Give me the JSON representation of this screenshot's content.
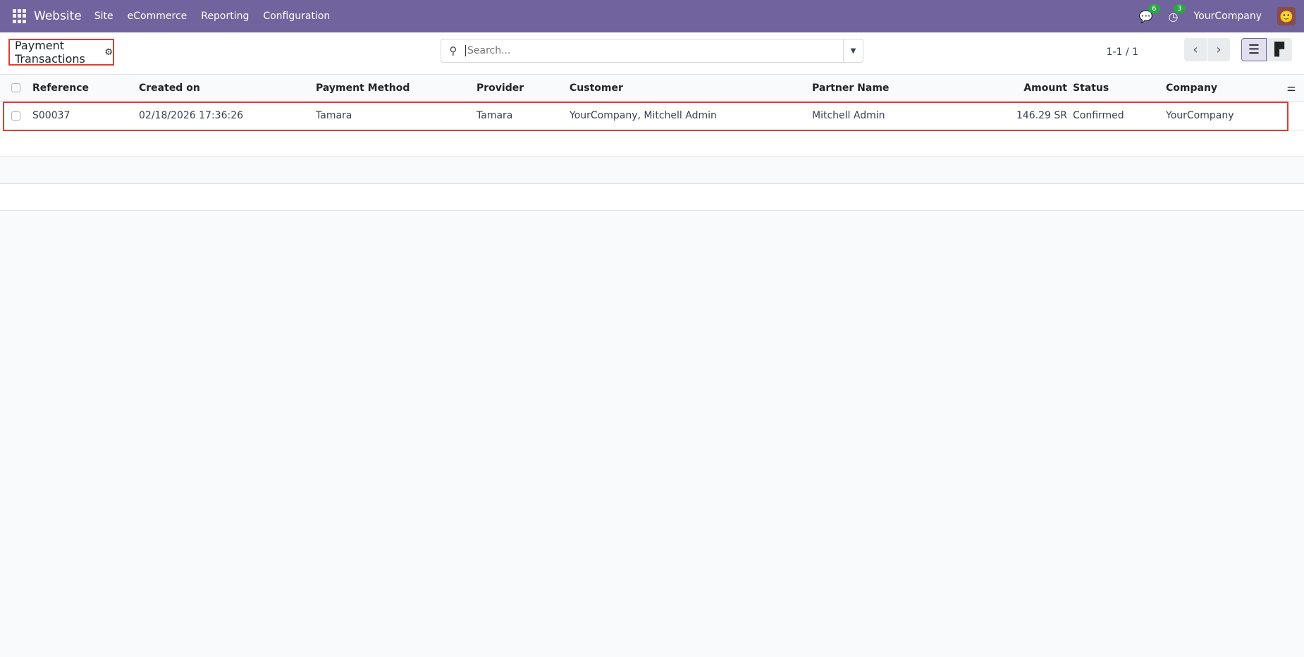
{
  "navbar": {
    "app": "Website",
    "menus": [
      "Site",
      "eCommerce",
      "Reporting",
      "Configuration"
    ],
    "messages_count": "6",
    "activities_count": "3",
    "company": "YourCompany"
  },
  "control_panel": {
    "title": "Payment Transactions",
    "search_placeholder": "Search...",
    "pager": "1-1 / 1"
  },
  "table": {
    "columns": [
      "Reference",
      "Created on",
      "Payment Method",
      "Provider",
      "Customer",
      "Partner Name",
      "Amount",
      "Status",
      "Company"
    ],
    "rows": [
      [
        "S00037",
        "02/18/2026 17:36:26",
        "Tamara",
        "Tamara",
        "YourCompany, Mitchell Admin",
        "Mitchell Admin",
        "146.29 SR",
        "Confirmed",
        "YourCompany"
      ]
    ]
  },
  "colors": {
    "navbar": "#71639e",
    "highlight": "#e53935"
  }
}
